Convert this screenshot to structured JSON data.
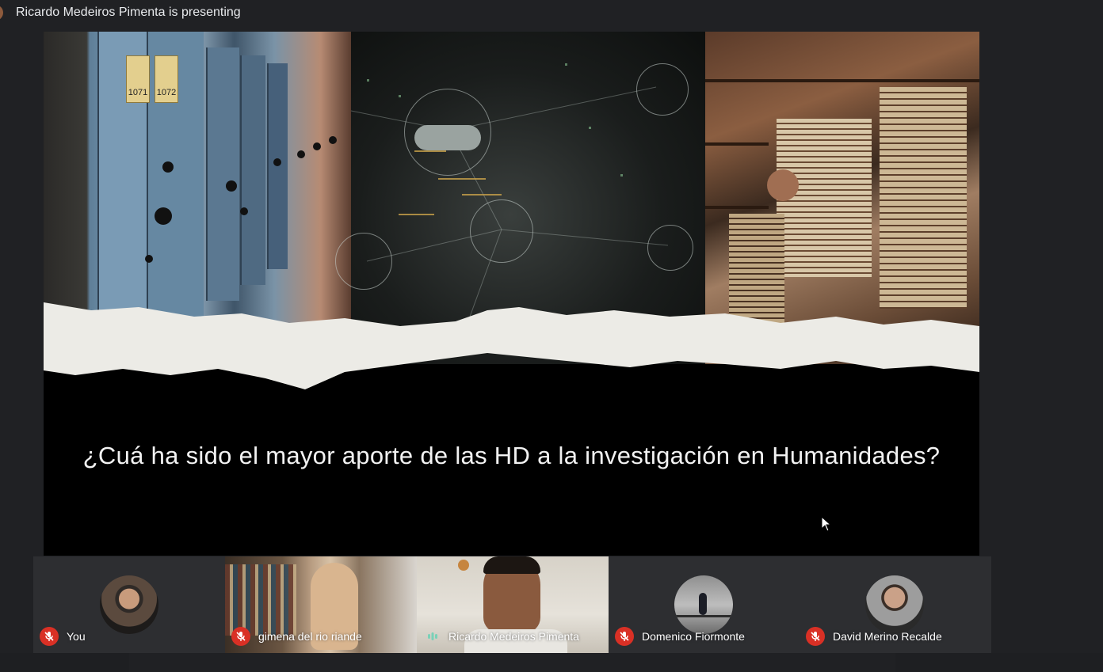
{
  "presenting": {
    "text": "Ricardo Medeiros Pimenta is presenting"
  },
  "slide": {
    "question": "¿Cuá ha sido el mayor aporte de las HD a la investigación en Humanidades?",
    "archive_labels": [
      "1071",
      "1072"
    ]
  },
  "participants": [
    {
      "name": "You",
      "muted": true,
      "view": "avatar"
    },
    {
      "name": "gimena del rio riande",
      "muted": true,
      "view": "video"
    },
    {
      "name": "Ricardo Medeiros Pimenta",
      "muted": false,
      "speaking": true,
      "view": "video"
    },
    {
      "name": "Domenico Fiormonte",
      "muted": true,
      "view": "avatar"
    },
    {
      "name": "David Merino Recalde",
      "muted": true,
      "view": "avatar"
    }
  ],
  "icons": {
    "mic_off": "mic-off-icon",
    "speaking": "speaking-indicator-icon",
    "cursor": "mouse-pointer-icon"
  },
  "colors": {
    "background": "#202124",
    "mic_off": "#d93025",
    "speaking": "#7ad1b8"
  }
}
